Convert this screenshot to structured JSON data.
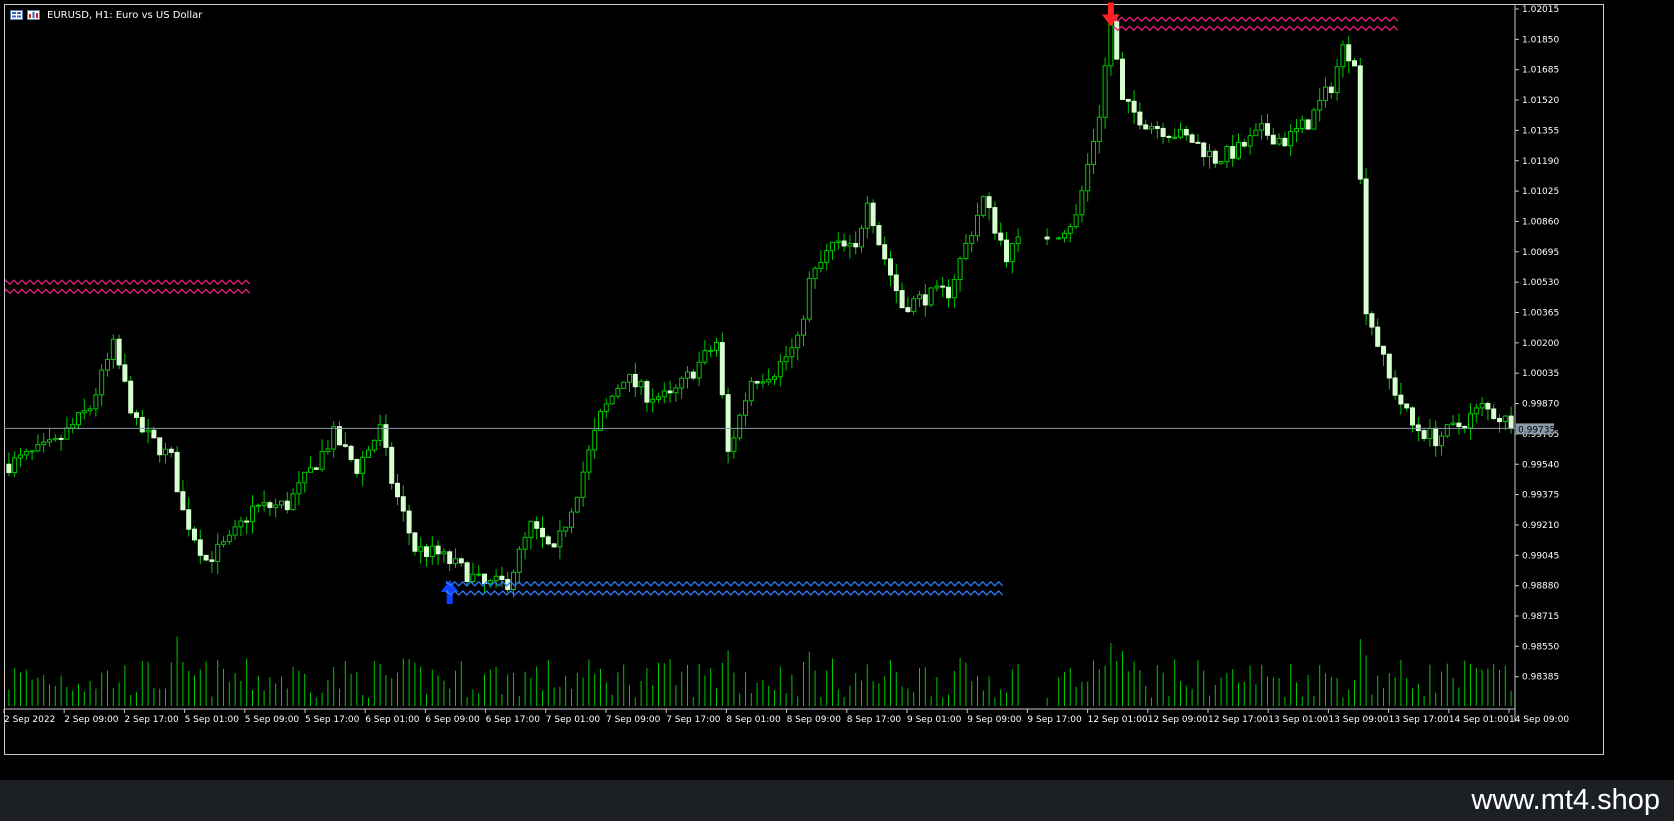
{
  "window": {
    "title": "EURUSD, H1:  Euro vs US Dollar",
    "background": "#000000",
    "grid_color": "#c8c8c8"
  },
  "icons": [
    "window-menu-icon",
    "chart-icon"
  ],
  "watermark": "www.mt4.shop",
  "current_price_label": "0.99735",
  "chart_data": {
    "type": "candlestick",
    "symbol": "EURUSD",
    "timeframe": "H1",
    "bull_color": "#00c800",
    "body_color": "#d8ffd0",
    "volume_color": "#00c800",
    "price_axis_ticks": [
      "1.02015",
      "1.01850",
      "1.01685",
      "1.01520",
      "1.01355",
      "1.01190",
      "1.01025",
      "1.00860",
      "1.00695",
      "1.00530",
      "1.00365",
      "1.00200",
      "1.00035",
      "0.99870",
      "0.99705",
      "0.99540",
      "0.99375",
      "0.99210",
      "0.99045",
      "0.98880",
      "0.98715",
      "0.98550",
      "0.98385"
    ],
    "time_axis_ticks": [
      "2 Sep 2022",
      "2 Sep 09:00",
      "2 Sep 17:00",
      "5 Sep 01:00",
      "5 Sep 09:00",
      "5 Sep 17:00",
      "6 Sep 01:00",
      "6 Sep 09:00",
      "6 Sep 17:00",
      "7 Sep 01:00",
      "7 Sep 09:00",
      "7 Sep 17:00",
      "8 Sep 01:00",
      "8 Sep 09:00",
      "8 Sep 17:00",
      "9 Sep 01:00",
      "9 Sep 09:00",
      "9 Sep 17:00",
      "12 Sep 01:00",
      "12 Sep 09:00",
      "12 Sep 17:00",
      "13 Sep 01:00",
      "13 Sep 09:00",
      "13 Sep 17:00",
      "14 Sep 01:00",
      "14 Sep 09:00"
    ],
    "ylim": [
      0.98385,
      1.02015
    ],
    "current_price": 0.99735,
    "close_path": [
      [
        0,
        0.9954
      ],
      [
        8,
        0.9965
      ],
      [
        14,
        0.9985
      ],
      [
        18,
        1.0018
      ],
      [
        22,
        0.9975
      ],
      [
        28,
        0.9957
      ],
      [
        30,
        0.9928
      ],
      [
        34,
        0.9902
      ],
      [
        38,
        0.9912
      ],
      [
        42,
        0.993
      ],
      [
        48,
        0.9932
      ],
      [
        52,
        0.995
      ],
      [
        56,
        0.997
      ],
      [
        60,
        0.9952
      ],
      [
        64,
        0.9973
      ],
      [
        66,
        0.9945
      ],
      [
        70,
        0.9908
      ],
      [
        74,
        0.9905
      ],
      [
        78,
        0.9897
      ],
      [
        82,
        0.9888
      ],
      [
        86,
        0.989
      ],
      [
        90,
        0.992
      ],
      [
        94,
        0.9905
      ],
      [
        98,
        0.994
      ],
      [
        102,
        0.998
      ],
      [
        106,
        1.0002
      ],
      [
        110,
        0.9992
      ],
      [
        114,
        0.999
      ],
      [
        118,
        1.0005
      ],
      [
        122,
        1.002
      ],
      [
        124,
        0.996
      ],
      [
        128,
        1.0
      ],
      [
        132,
        1.0005
      ],
      [
        136,
        1.002
      ],
      [
        138,
        1.0053
      ],
      [
        142,
        1.0073
      ],
      [
        146,
        1.007
      ],
      [
        148,
        1.01
      ],
      [
        150,
        1.0075
      ],
      [
        154,
        1.004
      ],
      [
        158,
        1.0045
      ],
      [
        162,
        1.0048
      ],
      [
        168,
        1.0098
      ],
      [
        172,
        1.0068
      ],
      [
        176,
        1.008
      ],
      [
        180,
        1.0078
      ],
      [
        184,
        1.0088
      ],
      [
        188,
        1.0145
      ],
      [
        190,
        1.0195
      ],
      [
        192,
        1.015
      ],
      [
        196,
        1.014
      ],
      [
        200,
        1.0135
      ],
      [
        204,
        1.013
      ],
      [
        208,
        1.012
      ],
      [
        212,
        1.0125
      ],
      [
        216,
        1.0135
      ],
      [
        220,
        1.013
      ],
      [
        224,
        1.014
      ],
      [
        228,
        1.016
      ],
      [
        230,
        1.018
      ],
      [
        232,
        1.0175
      ],
      [
        234,
        1.004
      ],
      [
        238,
        1.0
      ],
      [
        242,
        0.9975
      ],
      [
        246,
        0.9968
      ],
      [
        250,
        0.9975
      ],
      [
        254,
        0.9985
      ],
      [
        258,
        0.9978
      ]
    ],
    "annotations": [
      {
        "type": "sell-arrow",
        "x": 190,
        "price": 1.0205,
        "color": "#ff2020"
      },
      {
        "type": "buy-arrow",
        "x": 76,
        "price": 0.9878,
        "color": "#1040ff"
      },
      {
        "type": "resistance-zone",
        "x_start": 0,
        "x_end": 42,
        "price_top": 1.0053,
        "price_bottom": 1.0048,
        "color": "#e0207a"
      },
      {
        "type": "resistance-zone",
        "x_start": 191,
        "x_end": 240,
        "price_top": 1.0196,
        "price_bottom": 1.0191,
        "color": "#e0207a"
      },
      {
        "type": "support-zone",
        "x_start": 76,
        "x_end": 172,
        "price_top": 0.9889,
        "price_bottom": 0.9884,
        "color": "#2a7cff"
      }
    ]
  }
}
